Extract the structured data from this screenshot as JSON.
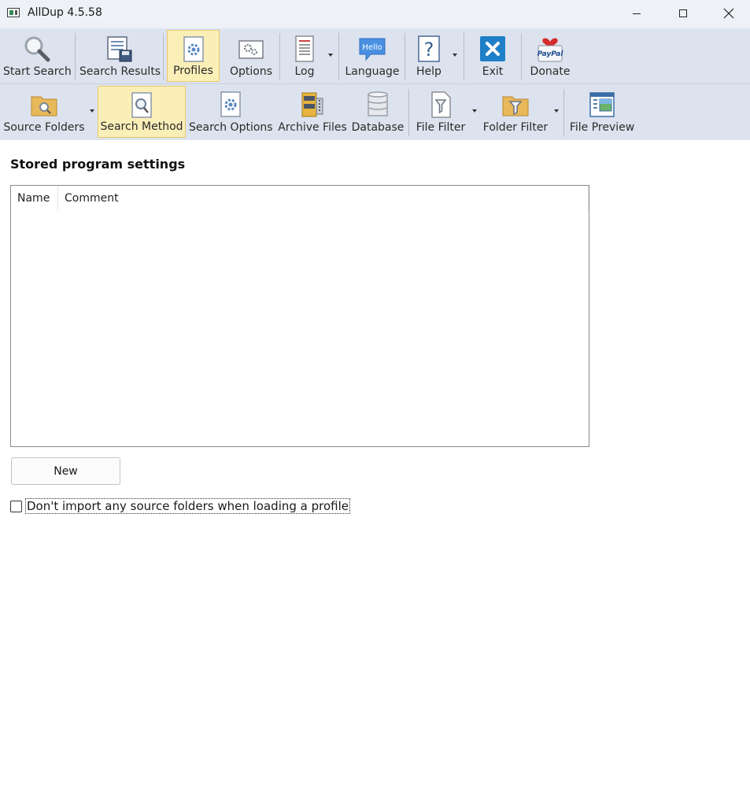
{
  "window": {
    "title": "AllDup 4.5.58",
    "controls": [
      "minimize",
      "maximize",
      "close"
    ]
  },
  "toolbar_main": {
    "items": [
      {
        "label": "Start Search",
        "icon": "magnifier-icon"
      },
      {
        "label": "Search Results",
        "icon": "search-results-icon"
      },
      {
        "label": "Profiles",
        "icon": "profiles-icon",
        "active": true
      },
      {
        "label": "Options",
        "icon": "options-icon"
      },
      {
        "label": "Log",
        "icon": "log-icon",
        "dropdown": true
      },
      {
        "label": "Language",
        "icon": "language-icon",
        "icon_text": "Hello"
      },
      {
        "label": "Help",
        "icon": "help-icon",
        "dropdown": true,
        "icon_text": "?"
      },
      {
        "label": "Exit",
        "icon": "exit-icon"
      },
      {
        "label": "Donate",
        "icon": "paypal-icon",
        "icon_text": "PayPal"
      }
    ]
  },
  "toolbar_sub": {
    "items": [
      {
        "label": "Source Folders",
        "icon": "source-folders-icon",
        "dropdown": true
      },
      {
        "label": "Search Method",
        "icon": "search-method-icon",
        "active": true
      },
      {
        "label": "Search Options",
        "icon": "search-options-icon"
      },
      {
        "label": "Archive Files",
        "icon": "archive-files-icon"
      },
      {
        "label": "Database",
        "icon": "database-icon"
      },
      {
        "label": "File Filter",
        "icon": "file-filter-icon",
        "dropdown": true
      },
      {
        "label": "Folder Filter",
        "icon": "folder-filter-icon",
        "dropdown": true
      },
      {
        "label": "File Preview",
        "icon": "file-preview-icon"
      }
    ]
  },
  "main": {
    "heading": "Stored program settings",
    "list": {
      "columns": [
        "Name",
        "Comment"
      ],
      "rows": []
    },
    "new_button": "New",
    "checkbox": {
      "label": "Don't import any source folders when loading a profile",
      "checked": false
    }
  },
  "colors": {
    "ribbon_bg": "#dde3ee",
    "active_bg": "#fbefb8",
    "active_border": "#e9c96a",
    "titlebar_bg": "#eef1f6"
  }
}
